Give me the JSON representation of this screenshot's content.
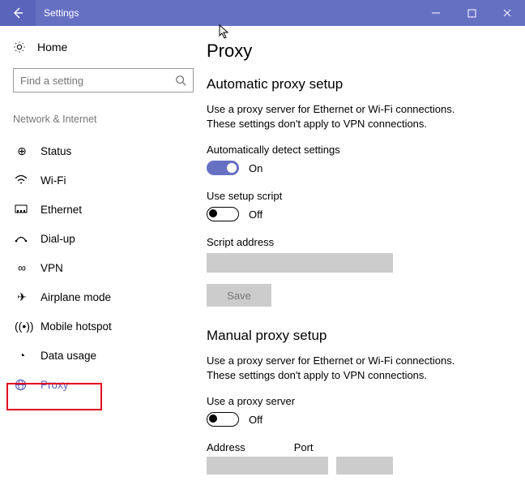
{
  "titlebar": {
    "title": "Settings"
  },
  "sidebar": {
    "home": "Home",
    "search_placeholder": "Find a setting",
    "section": "Network & Internet",
    "items": [
      {
        "label": "Status"
      },
      {
        "label": "Wi-Fi"
      },
      {
        "label": "Ethernet"
      },
      {
        "label": "Dial-up"
      },
      {
        "label": "VPN"
      },
      {
        "label": "Airplane mode"
      },
      {
        "label": "Mobile hotspot"
      },
      {
        "label": "Data usage"
      },
      {
        "label": "Proxy"
      }
    ]
  },
  "main": {
    "title": "Proxy",
    "auto": {
      "heading": "Automatic proxy setup",
      "desc": "Use a proxy server for Ethernet or Wi-Fi connections. These settings don't apply to VPN connections.",
      "detect_label": "Automatically detect settings",
      "detect_state": "On",
      "script_label": "Use setup script",
      "script_state": "Off",
      "address_label": "Script address",
      "save": "Save"
    },
    "manual": {
      "heading": "Manual proxy setup",
      "desc": "Use a proxy server for Ethernet or Wi-Fi connections. These settings don't apply to VPN connections.",
      "use_label": "Use a proxy server",
      "use_state": "Off",
      "addr": "Address",
      "port": "Port"
    }
  }
}
